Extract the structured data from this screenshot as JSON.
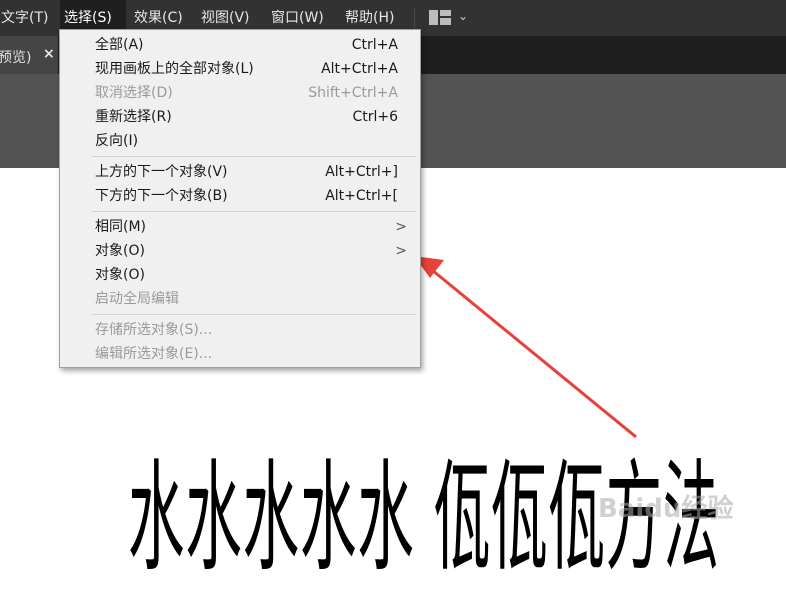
{
  "menubar": {
    "items": [
      "文字(T)",
      "选择(S)",
      "效果(C)",
      "视图(V)",
      "窗口(W)",
      "帮助(H)"
    ],
    "active_index": 1,
    "workspace_icon": "workspace-layout-icon",
    "workspace_chevron": "⌄"
  },
  "tab": {
    "label": "预览)",
    "close": "×"
  },
  "select_menu": {
    "items": [
      {
        "label": "全部(A)",
        "shortcut": "Ctrl+A",
        "enabled": true
      },
      {
        "label": "现用画板上的全部对象(L)",
        "shortcut": "Alt+Ctrl+A",
        "enabled": true
      },
      {
        "label": "取消选择(D)",
        "shortcut": "Shift+Ctrl+A",
        "enabled": false
      },
      {
        "label": "重新选择(R)",
        "shortcut": "Ctrl+6",
        "enabled": true
      },
      {
        "label": "反向(I)",
        "shortcut": "",
        "enabled": true
      },
      {
        "label": "上方的下一个对象(V)",
        "shortcut": "Alt+Ctrl+]",
        "enabled": true
      },
      {
        "label": "下方的下一个对象(B)",
        "shortcut": "Alt+Ctrl+[",
        "enabled": true
      },
      {
        "label": "相同(M)",
        "submenu": ">",
        "enabled": true
      },
      {
        "label": "对象(O)",
        "submenu": ">",
        "enabled": true
      },
      {
        "label": "对象(O)",
        "shortcut": "",
        "enabled": true
      },
      {
        "label": "启动全局编辑",
        "shortcut": "",
        "enabled": false
      },
      {
        "label": "存储所选对象(S)...",
        "shortcut": "",
        "enabled": false
      },
      {
        "label": "编辑所选对象(E)...",
        "shortcut": "",
        "enabled": false
      }
    ]
  },
  "canvas_text": "水水水水水 佤佤佤方法",
  "watermark": "Baidu经验",
  "colors": {
    "menubar_bg": "#323232",
    "menu_bg": "#f0f0f0",
    "disabled_text": "#9a9a9a",
    "annotation_arrow": "#e8403a"
  }
}
